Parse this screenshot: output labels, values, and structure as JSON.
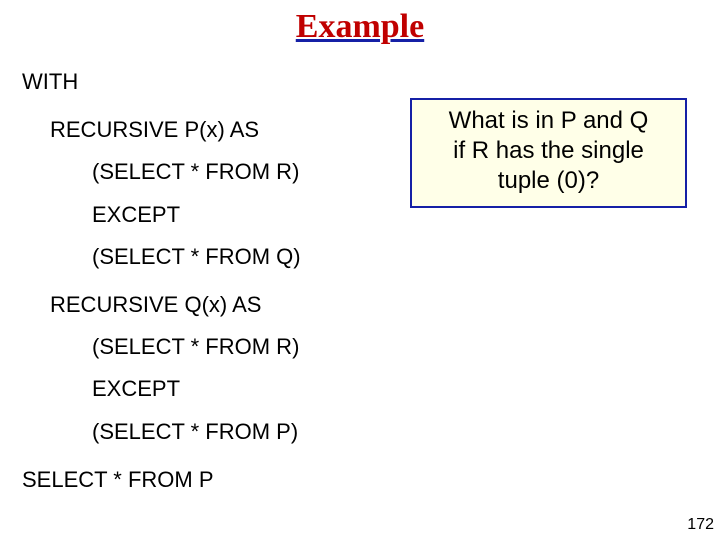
{
  "title": "Example",
  "code": {
    "l0": "WITH",
    "l1": "RECURSIVE P(x) AS",
    "l2": "(SELECT * FROM R)",
    "l3": "EXCEPT",
    "l4": "(SELECT * FROM Q)",
    "l5": "RECURSIVE Q(x) AS",
    "l6": "(SELECT * FROM R)",
    "l7": "EXCEPT",
    "l8": "(SELECT * FROM P)",
    "l9": "SELECT * FROM P"
  },
  "callout": {
    "line1": "What is in P and Q",
    "line2": "if R has the single",
    "line3": "tuple (0)?"
  },
  "page_number": "172"
}
